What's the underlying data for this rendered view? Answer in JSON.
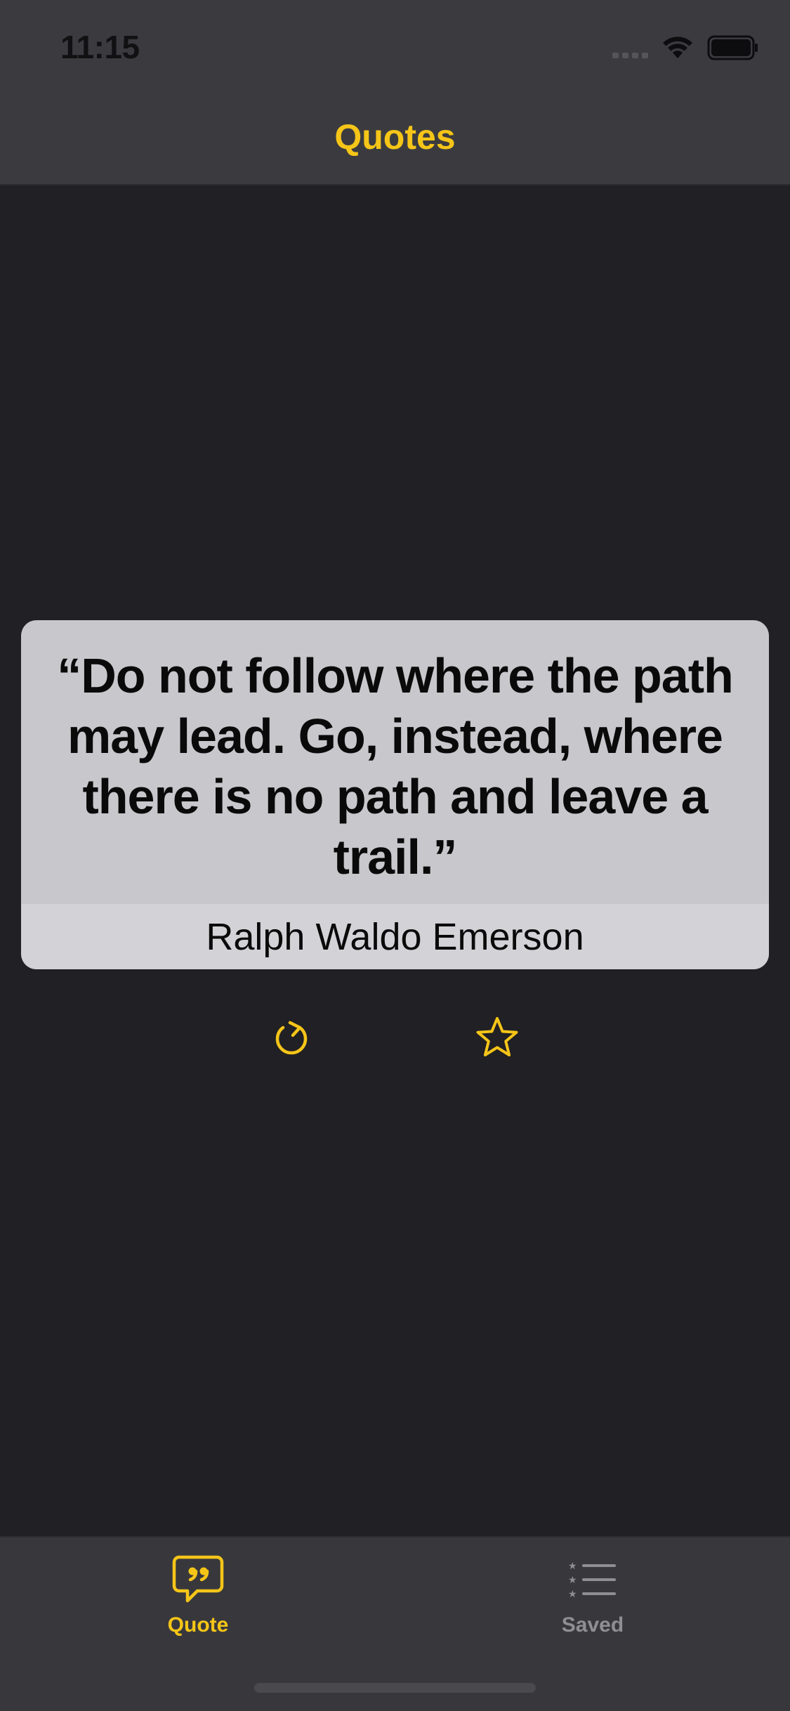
{
  "status_bar": {
    "time": "11:15"
  },
  "nav": {
    "title": "Quotes"
  },
  "quote": {
    "text": "“Do not follow where the path may lead. Go, instead, where there is no path and leave a trail.”",
    "author": "Ralph Waldo Emerson"
  },
  "actions": {
    "refresh_icon": "arrow-clockwise-icon",
    "favorite_icon": "star-outline-icon"
  },
  "tabbar": {
    "tabs": [
      {
        "label": "Quote",
        "icon": "quote-bubble-icon",
        "selected": true
      },
      {
        "label": "Saved",
        "icon": "starred-list-icon",
        "selected": false
      }
    ]
  },
  "colors": {
    "accent": "#f5c518",
    "background": "#212024",
    "header": "#3b3b3f",
    "card": "#c7c7cc",
    "card_footer": "#d2d2d7",
    "inactive": "#8e8e93"
  }
}
